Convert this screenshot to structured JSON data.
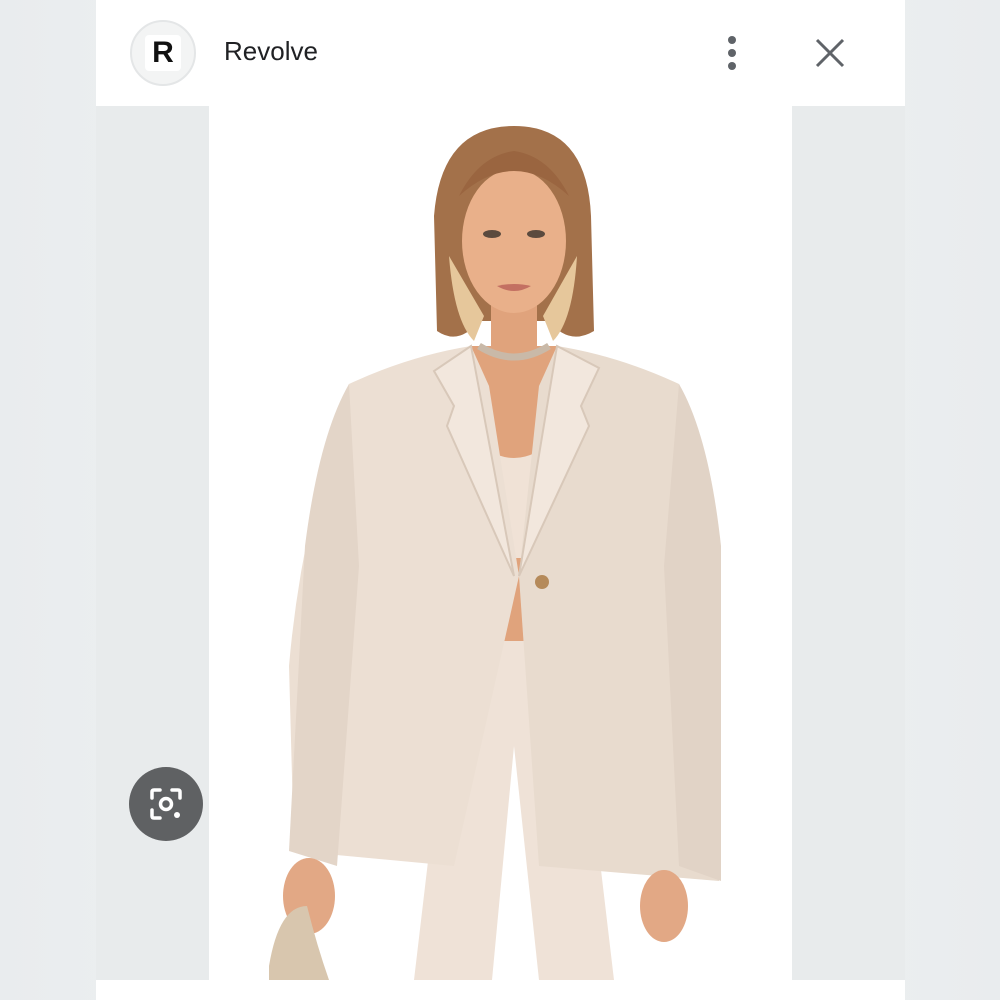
{
  "header": {
    "logo_letter": "R",
    "site_name": "Revolve",
    "more_icon": "more-vert-icon",
    "close_icon": "close-icon"
  },
  "image": {
    "subject": "model-in-cream-blazer"
  },
  "lens": {
    "icon": "lens-search-icon"
  },
  "colors": {
    "panel": "#ffffff",
    "side_bg": "#e8ebec",
    "lens_button": "#5f6163",
    "text": "#202124",
    "icon": "#5f6368"
  }
}
